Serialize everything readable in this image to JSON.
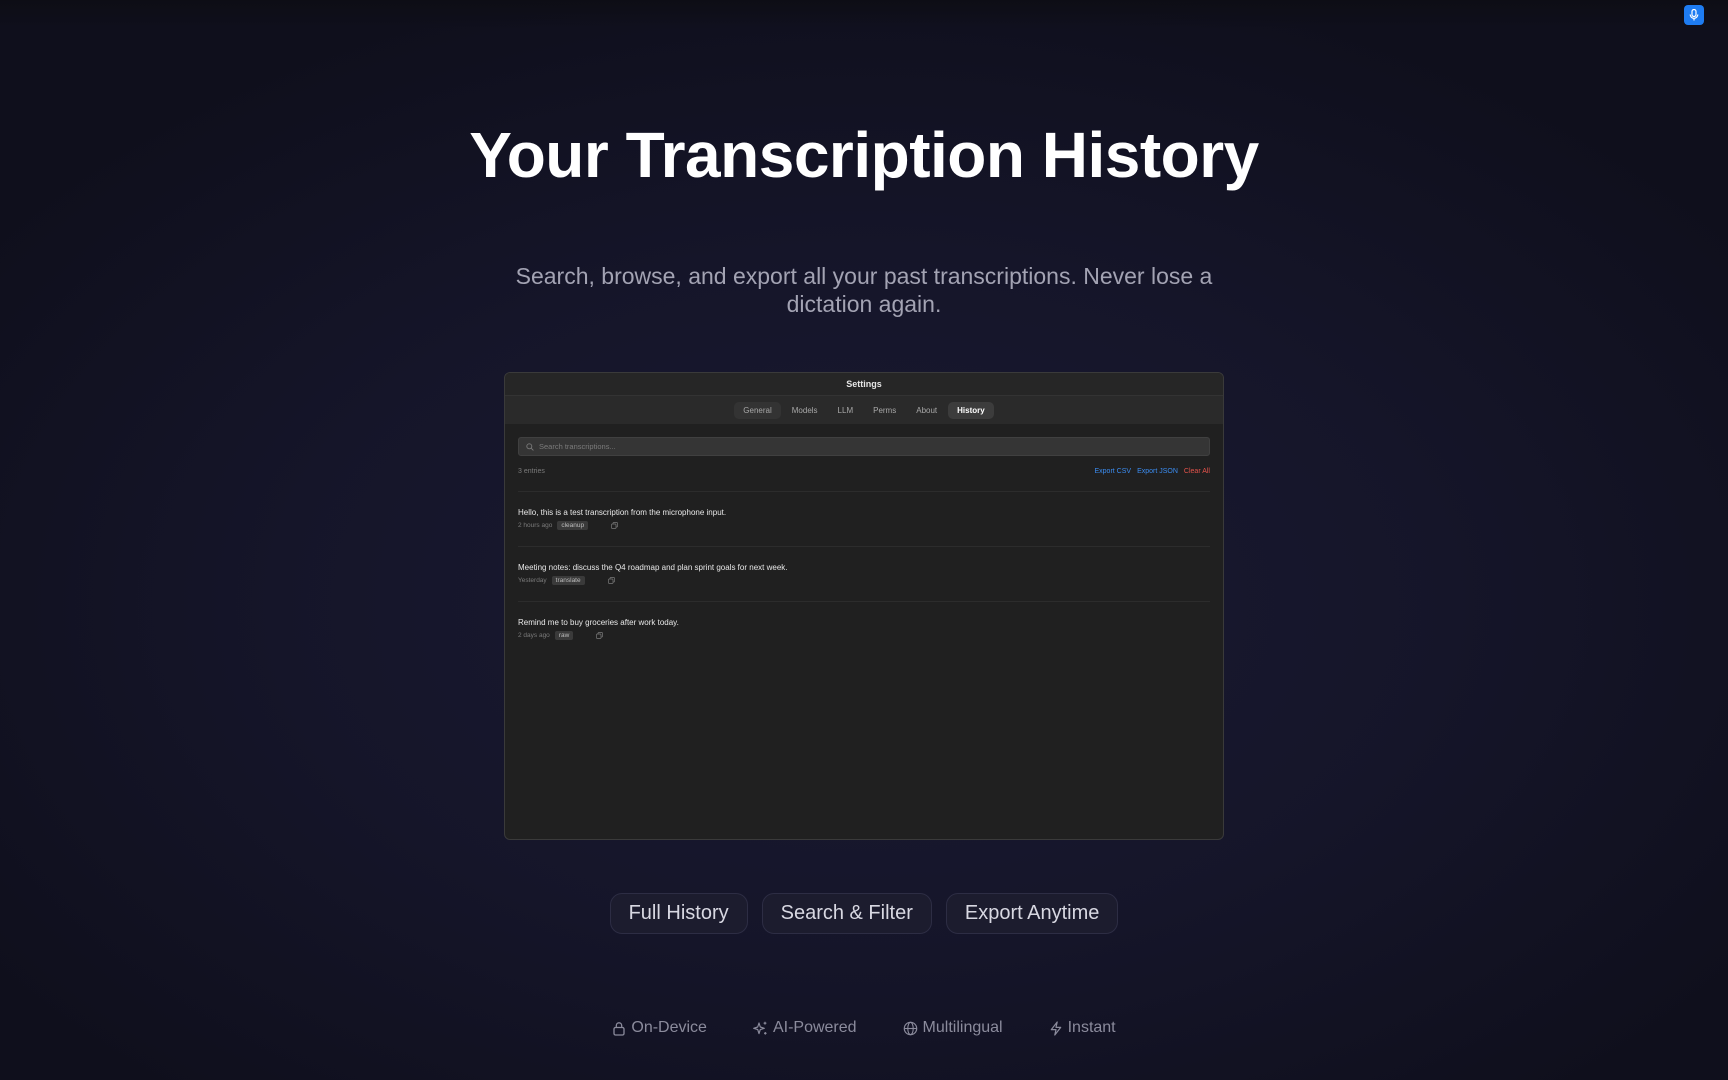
{
  "hero": {
    "title": "Your Transcription History",
    "subtitle": "Search, browse, and export all your past transcriptions. Never lose a dictation again."
  },
  "window": {
    "title": "Settings",
    "tabs": [
      "General",
      "Models",
      "LLM",
      "Perms",
      "About",
      "History"
    ],
    "active_tab": "History",
    "search": {
      "placeholder": "Search transcriptions..."
    },
    "entries_count": "3 entries",
    "actions": {
      "export_csv": "Export CSV",
      "export_json": "Export JSON",
      "clear_all": "Clear All"
    },
    "items": [
      {
        "text": "Hello, this is a test transcription from the microphone input.",
        "time": "2 hours ago",
        "tag": "cleanup"
      },
      {
        "text": "Meeting notes: discuss the Q4 roadmap and plan sprint goals for next week.",
        "time": "Yesterday",
        "tag": "translate"
      },
      {
        "text": "Remind me to buy groceries after work today.",
        "time": "2 days ago",
        "tag": "raw"
      }
    ]
  },
  "features": [
    "Full History",
    "Search & Filter",
    "Export Anytime"
  ],
  "badges": [
    {
      "label": "On-Device",
      "icon": "lock-icon"
    },
    {
      "label": "AI-Powered",
      "icon": "sparkles-icon"
    },
    {
      "label": "Multilingual",
      "icon": "globe-icon"
    },
    {
      "label": "Instant",
      "icon": "bolt-icon"
    }
  ],
  "colors": {
    "accent": "#1e7cf2",
    "link": "#3b8df2",
    "danger": "#e5534b"
  }
}
